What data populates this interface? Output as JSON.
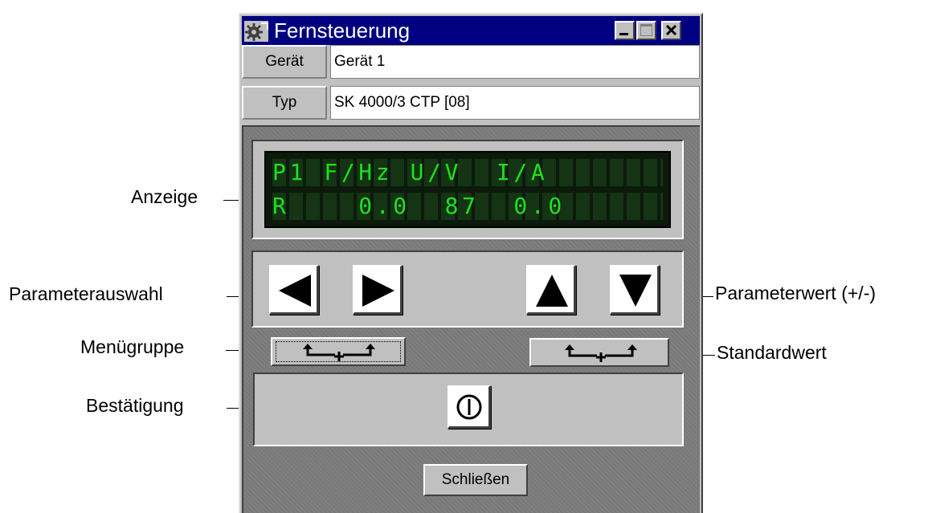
{
  "window": {
    "title": "Fernsteuerung",
    "icon": "gear-app-icon",
    "controls": [
      "minimize-icon",
      "maximize-icon",
      "close-icon"
    ]
  },
  "info": [
    {
      "label": "Gerät",
      "value": "Gerät 1"
    },
    {
      "label": "Typ",
      "value": "SK 4000/3 CTP [08]"
    }
  ],
  "display": {
    "line1": "P1 F/Hz U/V  I/A",
    "line2": "R    0.0  87  0.0",
    "text_color": "#1ee01e"
  },
  "buttons": {
    "param_left": "left-triangle-icon",
    "param_right": "right-triangle-icon",
    "value_up": "up-triangle-icon",
    "value_down": "down-triangle-icon",
    "menu_group": "enter-plus-enter-icon",
    "default_value": "enter-plus-enter-icon",
    "confirm": "power-icon",
    "close_label": "Schließen"
  },
  "annotations": {
    "anzeige": "Anzeige",
    "parameterauswahl": "Parameterauswahl",
    "parameterwert": "Parameterwert (+/-)",
    "menuegruppe": "Menügruppe",
    "standardwert": "Standardwert",
    "bestaetigung": "Bestätigung"
  },
  "colors": {
    "titlebar": "#000080",
    "face": "#c0c0c0",
    "panel": "#808080"
  }
}
